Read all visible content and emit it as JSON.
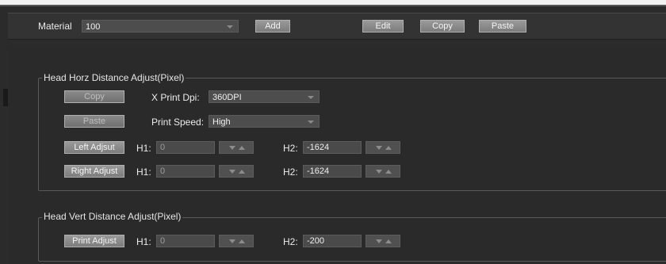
{
  "toolbar": {
    "material_label": "Material",
    "material_value": "100",
    "add_label": "Add",
    "edit_label": "Edit",
    "copy_label": "Copy",
    "paste_label": "Paste"
  },
  "horz_group": {
    "title": "Head Horz Distance Adjust(Pixel)",
    "copy_label": "Copy",
    "paste_label": "Paste",
    "xdpi_label": "X Print Dpi:",
    "xdpi_value": "360DPI",
    "speed_label": "Print Speed:",
    "speed_value": "High",
    "left_adjust_label": "Left Adjsut",
    "right_adjust_label": "Right Adjust",
    "h1_label": "H1:",
    "h2_label": "H2:",
    "left_h1": "0",
    "left_h2": "-1624",
    "right_h1": "0",
    "right_h2": "-1624"
  },
  "vert_group": {
    "title": "Head Vert Distance Adjust(Pixel)",
    "print_adjust_label": "Print Adjust",
    "h1_label": "H1:",
    "h2_label": "H2:",
    "h1": "0",
    "h2": "-200"
  },
  "colors": {
    "background": "#2b2b2b",
    "button": "#8a8a8a",
    "field": "#4a4a4a"
  }
}
